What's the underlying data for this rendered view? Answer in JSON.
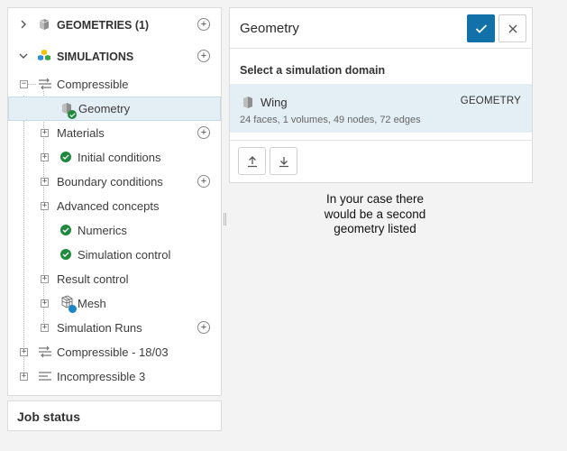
{
  "tree": {
    "geometries_label": "GEOMETRIES (1)",
    "simulations_label": "SIMULATIONS",
    "compressible_label": "Compressible",
    "geometry_label": "Geometry",
    "materials_label": "Materials",
    "initial_conditions_label": "Initial conditions",
    "boundary_conditions_label": "Boundary conditions",
    "advanced_concepts_label": "Advanced concepts",
    "numerics_label": "Numerics",
    "simulation_control_label": "Simulation control",
    "result_control_label": "Result control",
    "mesh_label": "Mesh",
    "simulation_runs_label": "Simulation Runs",
    "compressible_1803_label": "Compressible - 18/03",
    "incompressible_label": "Incompressible 3",
    "add_symbol": "+",
    "collapse_symbol": "−",
    "expand_symbol": "+"
  },
  "job_status": {
    "title": "Job status"
  },
  "geometry_panel": {
    "title": "Geometry",
    "subtitle": "Select a simulation domain",
    "item": {
      "name": "Wing",
      "type": "GEOMETRY",
      "description": "24 faces, 1 volumes, 49 nodes, 72 edges"
    }
  },
  "annotation": {
    "line1": "In your case there",
    "line2": "would be a second",
    "line3": "geometry listed"
  },
  "colors": {
    "accent": "#1271a8",
    "selected_bg": "#e3eef5",
    "success": "#1f8a3b",
    "mesh_badge": "#1a86c8"
  }
}
